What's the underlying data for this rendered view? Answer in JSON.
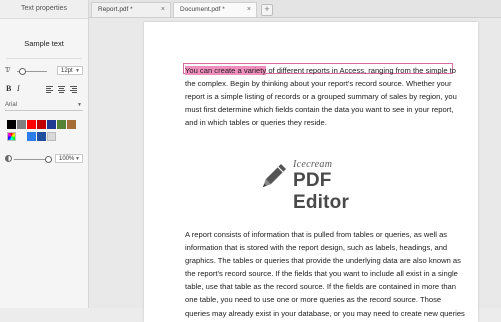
{
  "panel": {
    "title": "Text properties",
    "sample_text": "Sample text",
    "font_size": "12pt",
    "font_name": "Arial",
    "opacity": "100%",
    "swatches_row1": [
      "#000000",
      "#7f7f7f",
      "#ff0000",
      "#c00000",
      "#1f3a93",
      "#548235",
      "#a56c35"
    ],
    "swatches_row2": [
      "#ffffff",
      "#2b7de9",
      "#1f4e9f",
      "#d9d9d9"
    ]
  },
  "tabs": [
    {
      "label": "Report.pdf *",
      "close": "×"
    },
    {
      "label": "Document.pdf *",
      "close": "×"
    }
  ],
  "tab_add": "+",
  "document": {
    "para1_highlight": "You can create a variety",
    "para1_rest": " of different reports in Access, ranging from the simple to the complex. Begin by thinking about your report's record source. Whether your report is a simple listing of records or a grouped summary of sales by region, you must first determine which fields contain the data you want to see in your report, and in which tables or queries they reside.",
    "logo_top": "Icecream",
    "logo_main": "PDF Editor",
    "para2": "A report consists of information that is pulled from tables or queries, as well as information that is stored with the report design, such as labels, headings, and graphics. The tables or queries that provide the underlying data are also known as the report's record source. If the fields that you want to include all exist in a single table, use that table as the record source. If the fields are contained in more than one table, you need to use one or more queries as the record source. Those queries may already exist in your database, or you may need to create new queries"
  }
}
